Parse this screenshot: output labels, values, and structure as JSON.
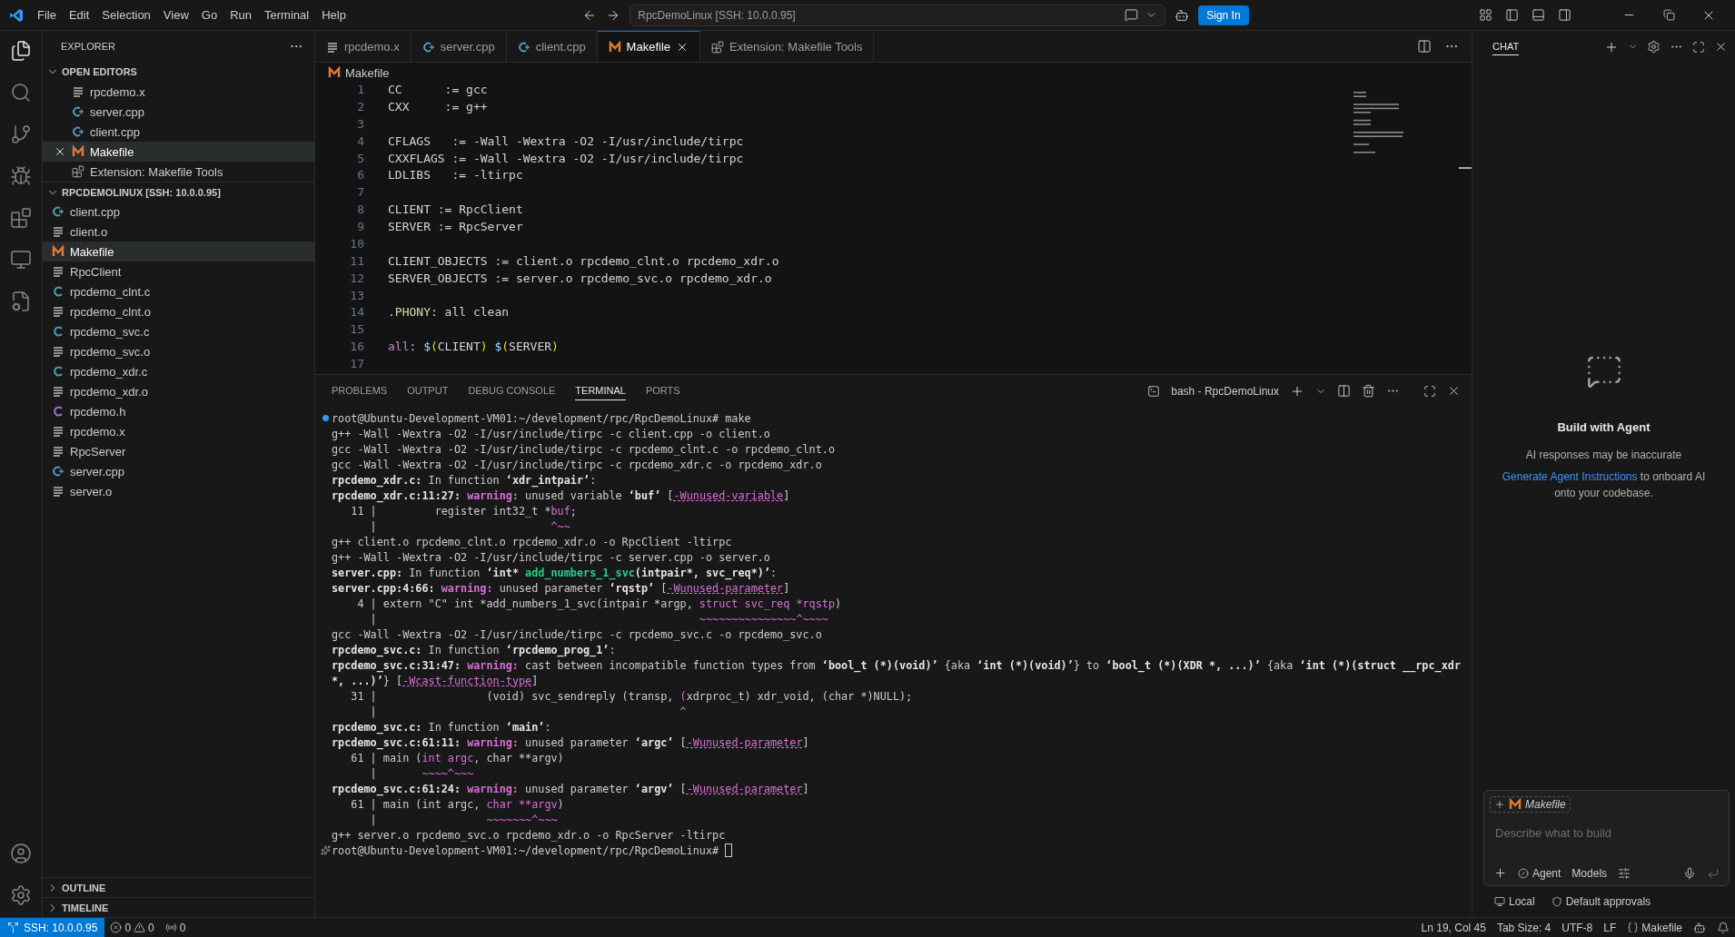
{
  "menu": [
    "File",
    "Edit",
    "Selection",
    "View",
    "Go",
    "Run",
    "Terminal",
    "Help"
  ],
  "command_center": "RpcDemoLinux [SSH: 10.0.0.95]",
  "sign_in": "Sign In",
  "explorer": {
    "title": "EXPLORER",
    "open_editors": {
      "title": "OPEN EDITORS",
      "expanded": true,
      "items": [
        {
          "name": "rpcdemo.x",
          "kind": "text",
          "selected": false
        },
        {
          "name": "server.cpp",
          "kind": "cpp",
          "selected": false
        },
        {
          "name": "client.cpp",
          "kind": "cpp",
          "selected": false
        },
        {
          "name": "Makefile",
          "kind": "make",
          "selected": true
        },
        {
          "name": "Extension: Makefile Tools",
          "kind": "ext",
          "selected": false
        }
      ]
    },
    "folder": {
      "title": "RPCDEMOLINUX [SSH: 10.0.0.95]",
      "expanded": true,
      "items": [
        {
          "name": "client.cpp",
          "kind": "cpp",
          "selected": false
        },
        {
          "name": "client.o",
          "kind": "text",
          "selected": false
        },
        {
          "name": "Makefile",
          "kind": "make",
          "selected": true
        },
        {
          "name": "RpcClient",
          "kind": "text",
          "selected": false
        },
        {
          "name": "rpcdemo_clnt.c",
          "kind": "c",
          "selected": false
        },
        {
          "name": "rpcdemo_clnt.o",
          "kind": "text",
          "selected": false
        },
        {
          "name": "rpcdemo_svc.c",
          "kind": "c",
          "selected": false
        },
        {
          "name": "rpcdemo_svc.o",
          "kind": "text",
          "selected": false
        },
        {
          "name": "rpcdemo_xdr.c",
          "kind": "c",
          "selected": false
        },
        {
          "name": "rpcdemo_xdr.o",
          "kind": "text",
          "selected": false
        },
        {
          "name": "rpcdemo.h",
          "kind": "h",
          "selected": false
        },
        {
          "name": "rpcdemo.x",
          "kind": "text",
          "selected": false
        },
        {
          "name": "RpcServer",
          "kind": "text",
          "selected": false
        },
        {
          "name": "server.cpp",
          "kind": "cpp",
          "selected": false
        },
        {
          "name": "server.o",
          "kind": "text",
          "selected": false
        }
      ]
    },
    "bottom_sections": [
      {
        "title": "OUTLINE",
        "expanded": false
      },
      {
        "title": "TIMELINE",
        "expanded": false
      }
    ]
  },
  "tabs": [
    {
      "label": "rpcdemo.x",
      "kind": "text",
      "selected": false
    },
    {
      "label": "server.cpp",
      "kind": "cpp",
      "selected": false
    },
    {
      "label": "client.cpp",
      "kind": "cpp",
      "selected": false
    },
    {
      "label": "Makefile",
      "kind": "make",
      "selected": true
    },
    {
      "label": "Extension: Makefile Tools",
      "kind": "ext",
      "selected": false
    }
  ],
  "breadcrumb": {
    "label": "Makefile",
    "kind": "make"
  },
  "code_lines": [
    {
      "number": "1",
      "segments": [
        {
          "text": "CC      := gcc",
          "kind": "plain"
        }
      ]
    },
    {
      "number": "2",
      "segments": [
        {
          "text": "CXX     := g++",
          "kind": "plain"
        }
      ]
    },
    {
      "number": "3"
    },
    {
      "number": "4",
      "segments": [
        {
          "text": "CFLAGS   := -Wall -Wextra -O2 -I/usr/include/tirpc",
          "kind": "plain"
        }
      ]
    },
    {
      "number": "5",
      "segments": [
        {
          "text": "CXXFLAGS := -Wall -Wextra -O2 -I/usr/include/tirpc",
          "kind": "plain"
        }
      ]
    },
    {
      "number": "6",
      "segments": [
        {
          "text": "LDLIBS   := -ltirpc",
          "kind": "plain"
        }
      ]
    },
    {
      "number": "7"
    },
    {
      "number": "8",
      "segments": [
        {
          "text": "CLIENT := RpcClient",
          "kind": "plain"
        }
      ]
    },
    {
      "number": "9",
      "segments": [
        {
          "text": "SERVER := RpcServer",
          "kind": "plain"
        }
      ]
    },
    {
      "number": "10"
    },
    {
      "number": "11",
      "segments": [
        {
          "text": "CLIENT_OBJECTS := client.o rpcdemo_clnt.o rpcdemo_xdr.o",
          "kind": "plain"
        }
      ]
    },
    {
      "number": "12",
      "segments": [
        {
          "text": "SERVER_OBJECTS := server.o rpcdemo_svc.o rpcdemo_xdr.o",
          "kind": "plain"
        }
      ]
    },
    {
      "number": "13"
    },
    {
      "number": "14",
      "segments": [
        {
          "text": ".PHONY",
          "kind": "special"
        },
        {
          "text": ": all clean",
          "kind": "plain"
        }
      ]
    },
    {
      "number": "15"
    },
    {
      "number": "16",
      "segments": [
        {
          "text": "all",
          "kind": "target"
        },
        {
          "text": ": ",
          "kind": "plain"
        },
        {
          "text": "$",
          "kind": "dollar"
        },
        {
          "text": "(",
          "kind": "paren"
        },
        {
          "text": "CLIENT",
          "kind": "plain"
        },
        {
          "text": ")",
          "kind": "paren"
        },
        {
          "text": " $",
          "kind": "dollar"
        },
        {
          "text": "(",
          "kind": "paren"
        },
        {
          "text": "SERVER",
          "kind": "plain"
        },
        {
          "text": ")",
          "kind": "paren"
        }
      ]
    },
    {
      "number": "17"
    }
  ],
  "panel": {
    "tabs": [
      {
        "label": "PROBLEMS",
        "selected": false
      },
      {
        "label": "OUTPUT",
        "selected": false
      },
      {
        "label": "DEBUG CONSOLE",
        "selected": false
      },
      {
        "label": "TERMINAL",
        "selected": true
      },
      {
        "label": "PORTS",
        "selected": false
      }
    ],
    "terminal_name": "bash - RpcDemoLinux",
    "lines": [
      {
        "kind": "command",
        "segments": [
          {
            "text": "root@Ubuntu-Development-VM01:~/development/rpc/RpcDemoLinux# make",
            "kind": "plain"
          }
        ]
      },
      {
        "kind": "output",
        "segments": [
          {
            "text": "g++ -Wall -Wextra -O2 -I/usr/include/tirpc -c client.cpp -o client.o",
            "kind": "plain"
          }
        ]
      },
      {
        "kind": "output",
        "segments": [
          {
            "text": "gcc -Wall -Wextra -O2 -I/usr/include/tirpc -c rpcdemo_clnt.c -o rpcdemo_clnt.o",
            "kind": "plain"
          }
        ]
      },
      {
        "kind": "output",
        "segments": [
          {
            "text": "gcc -Wall -Wextra -O2 -I/usr/include/tirpc -c rpcdemo_xdr.c -o rpcdemo_xdr.o",
            "kind": "plain"
          }
        ]
      },
      {
        "kind": "output",
        "segments": [
          {
            "text": "rpcdemo_xdr.c:",
            "kind": "bold"
          },
          {
            "text": " In function ",
            "kind": "plain"
          },
          {
            "text": "‘xdr_intpair’",
            "kind": "bold"
          },
          {
            "text": ":",
            "kind": "plain"
          }
        ]
      },
      {
        "kind": "output",
        "segments": [
          {
            "text": "rpcdemo_xdr.c:11:27: ",
            "kind": "bold"
          },
          {
            "text": "warning:",
            "kind": "warn"
          },
          {
            "text": " unused variable ",
            "kind": "plain"
          },
          {
            "text": "‘buf’",
            "kind": "bold"
          },
          {
            "text": " [",
            "kind": "plain"
          },
          {
            "text": "-Wunused-variable",
            "kind": "flag"
          },
          {
            "text": "]",
            "kind": "plain"
          }
        ]
      },
      {
        "kind": "output",
        "segments": [
          {
            "text": "   11 |         register int32_t *",
            "kind": "plain"
          },
          {
            "text": "buf",
            "kind": "mark"
          },
          {
            "text": ";",
            "kind": "plain"
          }
        ]
      },
      {
        "kind": "output",
        "segments": [
          {
            "text": "      |                           ",
            "kind": "plain"
          },
          {
            "text": "^~~",
            "kind": "mark"
          }
        ]
      },
      {
        "kind": "output",
        "segments": [
          {
            "text": "g++ client.o rpcdemo_clnt.o rpcdemo_xdr.o -o RpcClient -ltirpc",
            "kind": "plain"
          }
        ]
      },
      {
        "kind": "output",
        "segments": [
          {
            "text": "g++ -Wall -Wextra -O2 -I/usr/include/tirpc -c server.cpp -o server.o",
            "kind": "plain"
          }
        ]
      },
      {
        "kind": "output",
        "segments": [
          {
            "text": "server.cpp:",
            "kind": "bold"
          },
          {
            "text": " In function ",
            "kind": "plain"
          },
          {
            "text": "‘int* ",
            "kind": "bold"
          },
          {
            "text": "add_numbers_1_svc",
            "kind": "func"
          },
          {
            "text": "(intpair*, svc_req*)’",
            "kind": "bold"
          },
          {
            "text": ":",
            "kind": "plain"
          }
        ]
      },
      {
        "kind": "output",
        "segments": [
          {
            "text": "server.cpp:4:66: ",
            "kind": "bold"
          },
          {
            "text": "warning:",
            "kind": "warn"
          },
          {
            "text": " unused parameter ",
            "kind": "plain"
          },
          {
            "text": "‘rqstp’",
            "kind": "bold"
          },
          {
            "text": " [",
            "kind": "plain"
          },
          {
            "text": "-Wunused-parameter",
            "kind": "flag"
          },
          {
            "text": "]",
            "kind": "plain"
          }
        ]
      },
      {
        "kind": "output",
        "segments": [
          {
            "text": "    4 | extern \"C\" int *add_numbers_1_svc(intpair *argp, ",
            "kind": "plain"
          },
          {
            "text": "struct svc_req *rqstp",
            "kind": "mark"
          },
          {
            "text": ")",
            "kind": "plain"
          }
        ]
      },
      {
        "kind": "output",
        "segments": [
          {
            "text": "      |                                                  ",
            "kind": "plain"
          },
          {
            "text": "~~~~~~~~~~~~~~~^~~~~",
            "kind": "mark"
          }
        ]
      },
      {
        "kind": "output",
        "segments": [
          {
            "text": "gcc -Wall -Wextra -O2 -I/usr/include/tirpc -c rpcdemo_svc.c -o rpcdemo_svc.o",
            "kind": "plain"
          }
        ]
      },
      {
        "kind": "output",
        "segments": [
          {
            "text": "rpcdemo_svc.c:",
            "kind": "bold"
          },
          {
            "text": " In function ",
            "kind": "plain"
          },
          {
            "text": "‘rpcdemo_prog_1’",
            "kind": "bold"
          },
          {
            "text": ":",
            "kind": "plain"
          }
        ]
      },
      {
        "kind": "output",
        "segments": [
          {
            "text": "rpcdemo_svc.c:31:47: ",
            "kind": "bold"
          },
          {
            "text": "warning:",
            "kind": "warn"
          },
          {
            "text": " cast between incompatible function types from ",
            "kind": "plain"
          },
          {
            "text": "‘bool_t (*)(void)’",
            "kind": "bold"
          },
          {
            "text": " {aka ",
            "kind": "plain"
          },
          {
            "text": "‘int (*)(void)’",
            "kind": "bold"
          },
          {
            "text": "} to ",
            "kind": "plain"
          },
          {
            "text": "‘bool_t (*)(XDR *, ...)’",
            "kind": "bold"
          },
          {
            "text": " {aka ",
            "kind": "plain"
          },
          {
            "text": "‘int (*)(struct __rpc_xdr",
            "kind": "bold"
          }
        ]
      },
      {
        "kind": "output",
        "segments": [
          {
            "text": "*, ...)’",
            "kind": "bold"
          },
          {
            "text": "} [",
            "kind": "plain"
          },
          {
            "text": "-Wcast-function-type",
            "kind": "flag"
          },
          {
            "text": "]",
            "kind": "plain"
          }
        ]
      },
      {
        "kind": "output",
        "segments": [
          {
            "text": "   31 |                 (void) svc_sendreply (transp, ",
            "kind": "plain"
          },
          {
            "text": "(",
            "kind": "mark"
          },
          {
            "text": "xdrproc_t) xdr_void, (char *)NULL);",
            "kind": "plain"
          }
        ]
      },
      {
        "kind": "output",
        "segments": [
          {
            "text": "      |                                               ",
            "kind": "plain"
          },
          {
            "text": "^",
            "kind": "mark"
          }
        ]
      },
      {
        "kind": "output",
        "segments": [
          {
            "text": "rpcdemo_svc.c:",
            "kind": "bold"
          },
          {
            "text": " In function ",
            "kind": "plain"
          },
          {
            "text": "‘main’",
            "kind": "bold"
          },
          {
            "text": ":",
            "kind": "plain"
          }
        ]
      },
      {
        "kind": "output",
        "segments": [
          {
            "text": "rpcdemo_svc.c:61:11: ",
            "kind": "bold"
          },
          {
            "text": "warning:",
            "kind": "warn"
          },
          {
            "text": " unused parameter ",
            "kind": "plain"
          },
          {
            "text": "‘argc’",
            "kind": "bold"
          },
          {
            "text": " [",
            "kind": "plain"
          },
          {
            "text": "-Wunused-parameter",
            "kind": "flag"
          },
          {
            "text": "]",
            "kind": "plain"
          }
        ]
      },
      {
        "kind": "output",
        "segments": [
          {
            "text": "   61 | main (",
            "kind": "plain"
          },
          {
            "text": "int argc",
            "kind": "mark"
          },
          {
            "text": ", char **argv)",
            "kind": "plain"
          }
        ]
      },
      {
        "kind": "output",
        "segments": [
          {
            "text": "      |       ",
            "kind": "plain"
          },
          {
            "text": "~~~~^~~~",
            "kind": "mark"
          }
        ]
      },
      {
        "kind": "output",
        "segments": [
          {
            "text": "rpcdemo_svc.c:61:24: ",
            "kind": "bold"
          },
          {
            "text": "warning:",
            "kind": "warn"
          },
          {
            "text": " unused parameter ",
            "kind": "plain"
          },
          {
            "text": "‘argv’",
            "kind": "bold"
          },
          {
            "text": " [",
            "kind": "plain"
          },
          {
            "text": "-Wunused-parameter",
            "kind": "flag"
          },
          {
            "text": "]",
            "kind": "plain"
          }
        ]
      },
      {
        "kind": "output",
        "segments": [
          {
            "text": "   61 | main (int argc, ",
            "kind": "plain"
          },
          {
            "text": "char **argv",
            "kind": "mark"
          },
          {
            "text": ")",
            "kind": "plain"
          }
        ]
      },
      {
        "kind": "output",
        "segments": [
          {
            "text": "      |                 ",
            "kind": "plain"
          },
          {
            "text": "~~~~~~~^~~~",
            "kind": "mark"
          }
        ]
      },
      {
        "kind": "output",
        "segments": [
          {
            "text": "g++ server.o rpcdemo_svc.o rpcdemo_xdr.o -o RpcServer -ltirpc",
            "kind": "plain"
          }
        ]
      },
      {
        "kind": "current",
        "segments": [
          {
            "text": "root@Ubuntu-Development-VM01:~/development/rpc/RpcDemoLinux# ",
            "kind": "plain"
          }
        ]
      }
    ]
  },
  "chat": {
    "title": "CHAT",
    "heading": "Build with Agent",
    "notice": "AI responses may be inaccurate",
    "link": "Generate Agent Instructions",
    "hint": " to onboard AI onto your codebase.",
    "attachment": "Makefile",
    "placeholder": "Describe what to build",
    "mode": "Agent",
    "models": "Models",
    "footer": [
      "Local",
      "Default approvals"
    ]
  },
  "status": {
    "remote": "SSH: 10.0.0.95",
    "errors": "0",
    "warnings": "0",
    "ports": "0",
    "right": [
      "Ln 19, Col 45",
      "Tab Size: 4",
      "UTF-8",
      "LF"
    ],
    "language": "Makefile"
  }
}
